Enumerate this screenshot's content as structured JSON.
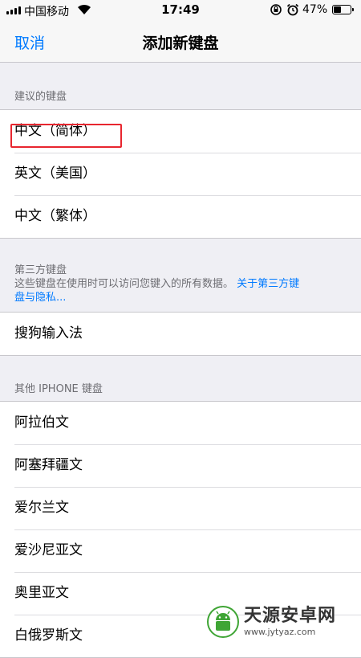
{
  "status_bar": {
    "carrier": "中国移动",
    "time": "17:49",
    "battery_percent": "47%",
    "battery_level": 0.47,
    "signal_bars": 4
  },
  "nav": {
    "cancel_label": "取消",
    "title": "添加新键盘"
  },
  "suggested": {
    "header": "建议的键盘",
    "items": [
      "中文（简体）",
      "英文（美国）",
      "中文（繁体）"
    ]
  },
  "third_party": {
    "header_line1": "第三方键盘",
    "description": "这些键盘在使用时可以访问您键入的所有数据。",
    "link_text_line1": "关于第三方键",
    "link_text_line2": "盘与隐私...",
    "items": [
      "搜狗输入法"
    ]
  },
  "other": {
    "header": "其他 IPHONE 键盘",
    "items": [
      "阿拉伯文",
      "阿塞拜疆文",
      "爱尔兰文",
      "爱沙尼亚文",
      "奥里亚文",
      "白俄罗斯文"
    ]
  },
  "watermark": {
    "name": "天源安卓网",
    "url": "www.jytyaz.com"
  },
  "colors": {
    "accent": "#007aff",
    "highlight": "#e8262f",
    "background": "#efeff4"
  }
}
